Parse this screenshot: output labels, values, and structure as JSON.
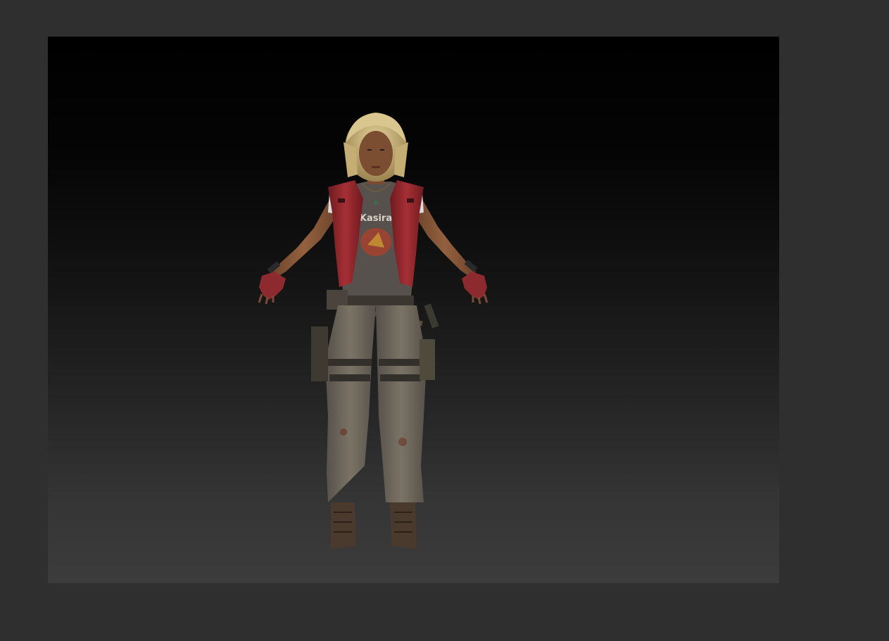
{
  "viewport": {
    "content": "3d-character-model-a-pose",
    "shading": "textured",
    "background": "vertical-gradient",
    "colors": {
      "app_background": "#2f2f2f",
      "viewport_top": "#000000",
      "viewport_bottom": "#3c3c3c"
    }
  },
  "model": {
    "icon": "character-model",
    "shirt_print": "Kasira",
    "colors": {
      "hair": "#c9b27a",
      "skin": "#8a5a3c",
      "vest": "#9b2a2e",
      "shirt": "#55504d",
      "pants": "#6f665a",
      "boots": "#4a3a2e",
      "straps": "#3a342f"
    }
  }
}
